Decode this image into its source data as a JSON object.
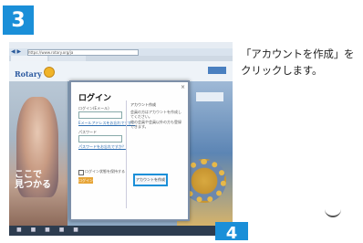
{
  "step3": {
    "number": "3"
  },
  "step4": {
    "number": "4"
  },
  "instruction": {
    "line1": "「アカウントを作成」を",
    "line2": "クリックします。"
  },
  "screenshot": {
    "nav_buttons": "◀ ▶",
    "url": "https://www.rotary.org/ja",
    "logo_text": "Rotary",
    "hero_caption_line1": "ここで",
    "hero_caption_line2": "見つかる",
    "taskbar_icons": "■ ■ ■ ■ ■",
    "dialog": {
      "close_label": "×",
      "title": "ログイン",
      "email_label": "ログイン(Eメール)",
      "forgot_email": "Eメールアドレスをお忘れですか？",
      "password_label": "パスワード",
      "forgot_password": "パスワードをお忘れですか？",
      "remember_label": "ログイン状態を保持する",
      "login_button": "ログイン",
      "right_heading": "アカウント作成",
      "right_text_1": "会員の方はアカウントを作成してください。",
      "right_text_2": "他の会員や会員以外の方も登録できます。",
      "create_button": "アカウントを作成"
    }
  },
  "colors": {
    "step_badge": "#1a8fd8",
    "highlight_border": "#1a8fd8",
    "login_button": "#e7a537",
    "logo": "#2c5aa0"
  }
}
